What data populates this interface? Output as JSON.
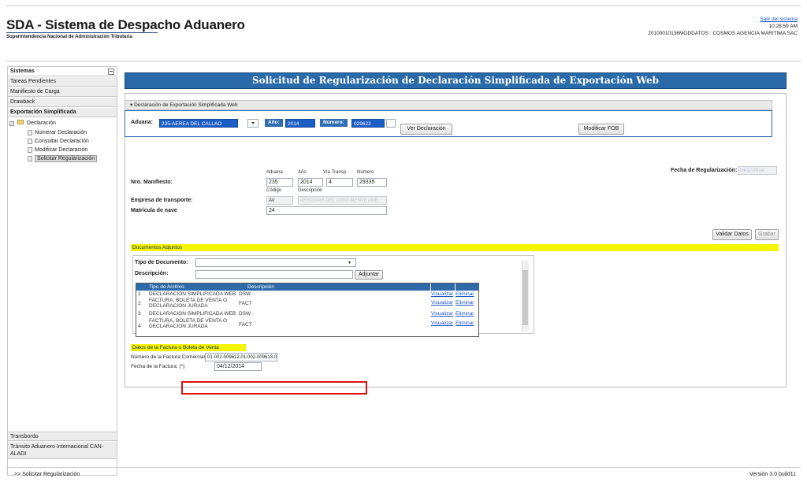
{
  "header": {
    "title": "SDA - Sistema de Despacho Aduanero",
    "subtitle": "Superintendencia Nacional de Administración Tributaria",
    "logout": "Salir del sistema",
    "time": "10:28:59 AM",
    "user": "20100010136MODDATOS : COSMOS AGENCIA MARITIMA SAC"
  },
  "sidebar": {
    "items": [
      "Sistemas",
      "Tareas Pendientes",
      "Manifiesto de Carga",
      "Drawback",
      "Exportación Simplificada"
    ],
    "tree_root": "Declaración",
    "tree_items": [
      "Numerar Declaración",
      "Consultar Declaración",
      "Modificar Declaración",
      "Solicitar Regularización"
    ],
    "bottom_items": [
      "Transbordo",
      "Tránsito Aduanero Internacional CAN-ALADI"
    ]
  },
  "main": {
    "title": "Solicitud de Regularización de Declaración Simplificada de Exportación Web",
    "panel_title": "▾ Declaración de Exportación Simplificada Web",
    "aduana_label": "Aduana:",
    "aduana_value": "235-AEREA DEL CALLAO",
    "anio_label": "Año:",
    "anio_value": "2014",
    "numero_label": "Número:",
    "numero_value": "029622",
    "ver_button": "Ver Declaración",
    "modificar_button": "Modificar FOB",
    "nro_manifiesto_label": "Nro. Manifiesto:",
    "col_aduana": "Aduana",
    "col_anio": "Año",
    "col_via": "Vía Transp.",
    "col_numero": "Número",
    "manifiesto_aduana": "235",
    "manifiesto_anio": "2014",
    "manifiesto_via": "4",
    "manifiesto_numero": "29335",
    "col_codigo": "Código",
    "col_descripcion": "Descripción",
    "empresa_label": "Empresa de transporte:",
    "empresa_codigo": "AV",
    "empresa_desc": "AEROVIAS DEL CONTINENTE AME",
    "matricula_label": "Matrícula de nave",
    "matricula_value": "24",
    "fecha_reg_label": "Fecha de Regularización:",
    "fecha_reg_value": "04/12/2014",
    "validar_button": "Validar Datos",
    "grabar_button": "Grabar",
    "docs_title": "Documentos Adjuntos",
    "tipo_doc_label": "Tipo de Documento:",
    "descripcion_label": "Descripción:",
    "adjuntar_button": "Adjuntar",
    "table_headers": [
      "Tipo de Archivo",
      "Descripción"
    ],
    "rows": [
      {
        "num": "1",
        "tipo": "DECLARACION SIMPLIFICADA WEB",
        "desc": "DSW",
        "ver": "Visualizar",
        "del": "Eliminar"
      },
      {
        "num": "2",
        "tipo": "FACTURA, BOLETA DE VENTA O DECLARACION JURADA",
        "desc": "FACT",
        "ver": "Visualizar",
        "del": "Eliminar"
      },
      {
        "num": "3",
        "tipo": "DECLARACION SIMPLIFICADA WEB",
        "desc": "DSW",
        "ver": "Visualizar",
        "del": "Eliminar"
      },
      {
        "num": "4",
        "tipo": "FACTURA, BOLETA DE VENTA O DECLARACION JURADA",
        "desc": "FACT",
        "ver": "Visualizar",
        "del": "Eliminar"
      }
    ],
    "factura_title": "Datos de la Factura o Boleta de Venta",
    "factura_num_label": "Número de la Factura Comercial: (*)",
    "factura_num_value": "01-002-009612,01-002-009613,0",
    "factura_fecha_label": "Fecha de la Factura: (*)",
    "factura_fecha_value": "04/12/2014"
  },
  "footer": {
    "breadcrumb": ">> Solicitar Regularización",
    "version": "Versión 3.0 build11"
  }
}
